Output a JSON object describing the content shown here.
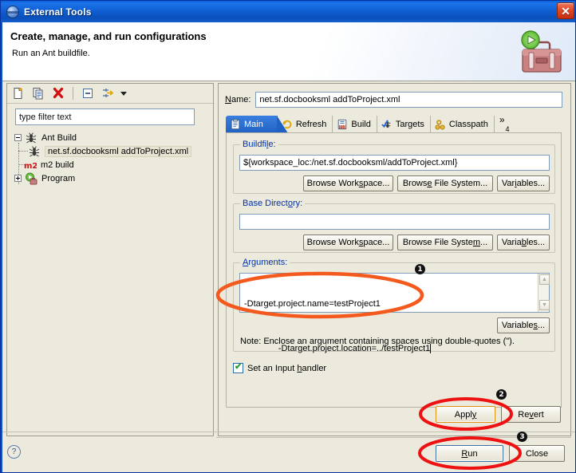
{
  "window": {
    "title": "External Tools",
    "title_icon": "eclipse-sphere-icon",
    "close_label": "✕"
  },
  "header": {
    "title": "Create, manage, and run configurations",
    "subtitle": "Run an Ant buildfile.",
    "icon": "toolbox-with-run-arrow-icon"
  },
  "left_panel": {
    "toolbar": [
      {
        "name": "new-launch-configuration-icon",
        "tooltip": "New launch configuration"
      },
      {
        "name": "duplicate-icon",
        "tooltip": "Duplicates the currently selected launch configuration"
      },
      {
        "name": "delete-icon",
        "tooltip": "Delete the selected launch configuration(s)"
      },
      {
        "name": "collapse-all-icon",
        "tooltip": "Collapse All"
      },
      {
        "name": "filter-icon",
        "tooltip": "Filter launch configurations"
      }
    ],
    "filter": {
      "value": "type filter text",
      "placeholder": "type filter text"
    },
    "tree": [
      {
        "label": "Ant Build",
        "icon": "ant-icon",
        "expanded": true,
        "level": 0,
        "selected": false
      },
      {
        "label": "net.sf.docbooksml addToProject.xml",
        "icon": "ant-icon",
        "level": 1,
        "selected": true
      },
      {
        "label": "m2 build",
        "icon": "m2-icon",
        "level": 0,
        "selected": false
      },
      {
        "label": "Program",
        "icon": "program-run-icon",
        "expanded": false,
        "level": 0,
        "selected": false
      }
    ]
  },
  "right_panel": {
    "name_label": "Name:",
    "name_value": "net.sf.docbooksml addToProject.xml",
    "tabs": [
      {
        "label": "Main",
        "icon": "main-tab-icon",
        "active": true
      },
      {
        "label": "Refresh",
        "icon": "refresh-tab-icon",
        "active": false
      },
      {
        "label": "Build",
        "icon": "build-tab-icon",
        "active": false
      },
      {
        "label": "Targets",
        "icon": "targets-tab-icon",
        "active": false
      },
      {
        "label": "Classpath",
        "icon": "classpath-tab-icon",
        "active": false
      }
    ],
    "tabs_overflow": {
      "chevron": "»",
      "count": "4"
    },
    "buildfile": {
      "legend": "Buildfile:",
      "value": "${workspace_loc:/net.sf.docbooksml/addToProject.xml}",
      "browse_workspace": "Browse Workspace...",
      "browse_file_system": "Browse File System...",
      "variables": "Variables..."
    },
    "base_directory": {
      "legend": "Base Directory:",
      "value": "",
      "browse_workspace": "Browse Workspace...",
      "browse_file_system": "Browse File System...",
      "variables": "Variables..."
    },
    "arguments": {
      "legend": "Arguments:",
      "line1": "-Dtarget.project.name=testProject1",
      "line2": "-Dtarget.project.location=../testProject1",
      "variables": "Variables...",
      "note": "Note: Enclose an argument containing spaces using double-quotes (\")."
    },
    "input_handler": {
      "label": "Set an Input handler",
      "checked": true
    }
  },
  "footer": {
    "apply": "Apply",
    "revert": "Revert",
    "run": "Run",
    "close": "Close",
    "help_icon": "?"
  },
  "annotations": [
    {
      "id": "1",
      "label": "1",
      "target": "arguments-field"
    },
    {
      "id": "2",
      "label": "2",
      "target": "apply-button"
    },
    {
      "id": "3",
      "label": "3",
      "target": "run-button"
    }
  ],
  "colors": {
    "annotation_orange": "#f4591d",
    "annotation_red": "#ee1111",
    "title_blue": "#0f5ed2",
    "dialog_bg": "#ece9dd",
    "legend_blue": "#0033aa"
  }
}
